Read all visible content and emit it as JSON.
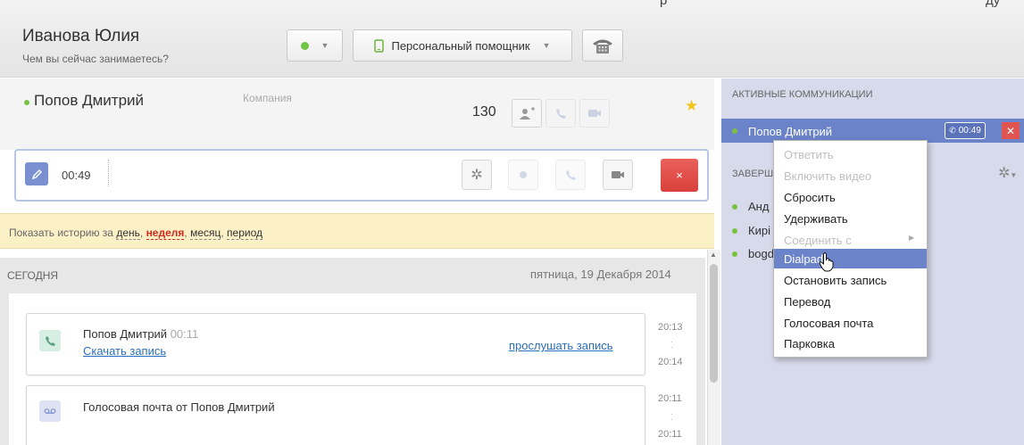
{
  "header": {
    "top_fragment_1": "р",
    "top_fragment_2": "ду",
    "user_name": "Иванова Юлия",
    "user_status": "Чем вы сейчас занимаетесь?",
    "assistant_label": "Персональный помощник"
  },
  "contact": {
    "name": "Попов Дмитрий",
    "company_label": "Компания",
    "count": "130"
  },
  "call": {
    "timer": "00:49",
    "close_label": "×"
  },
  "history": {
    "prefix": "Показать историю за",
    "options": [
      "день",
      "неделя",
      "месяц",
      "период"
    ],
    "active": "неделя"
  },
  "feed": {
    "today_label": "СЕГОДНЯ",
    "date": "пятница, 19 Декабря 2014",
    "items": [
      {
        "title": "Попов Дмитрий",
        "duration": "00:11",
        "link": "Скачать запись",
        "action": "прослушать запись",
        "time_start": "20:13",
        "time_end": "20:14"
      },
      {
        "title": "Голосовая почта от Попов Дмитрий",
        "time_start": "20:11",
        "time_end": "20:11"
      }
    ]
  },
  "right": {
    "active_header": "АКТИВНЫЕ КОММУНИКАЦИИ",
    "active_name": "Попов Дмитрий",
    "active_time": "00:49",
    "finished_header_visible": "ЗАВЕРШ",
    "finished_items_visible": [
      "Анд",
      "Кирі",
      "bogd"
    ]
  },
  "menu": {
    "items": [
      {
        "label": "Ответить",
        "enabled": false
      },
      {
        "label": "Включить видео",
        "enabled": false
      },
      {
        "label": "Сбросить",
        "enabled": true
      },
      {
        "label": "Удерживать",
        "enabled": true
      },
      {
        "label": "Соединить с",
        "enabled": false
      },
      {
        "label": "Dialpad",
        "enabled": true,
        "highlighted": true
      },
      {
        "label": "Остановить запись",
        "enabled": true
      },
      {
        "label": "Перевод",
        "enabled": true
      },
      {
        "label": "Голосовая почта",
        "enabled": true
      },
      {
        "label": "Парковка",
        "enabled": true
      }
    ]
  },
  "colors": {
    "accent": "#6b83c9",
    "online": "#7ac143",
    "danger": "#e05552",
    "history_bg": "#fbf0c6"
  }
}
